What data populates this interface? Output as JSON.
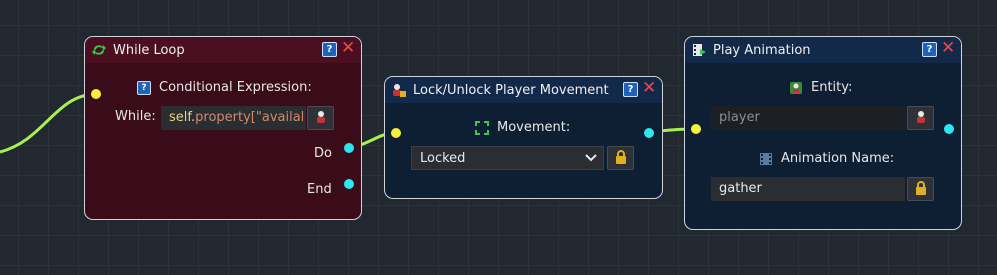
{
  "colors": {
    "wire": "#a8f050",
    "while_bg": "#3a0b18",
    "while_header": "#4a1022",
    "lock_bg": "#0e1e33",
    "lock_header": "#13294a",
    "exec_port": "#f6f03a",
    "out_port": "#2ee7ee"
  },
  "while_node": {
    "title": "While Loop",
    "help_label": "?",
    "close_label": "✕",
    "cond_label": "Conditional Expression:",
    "while_label": "While:",
    "expr_self": "self.",
    "expr_rest": "property[\"availal",
    "do_label": "Do",
    "end_label": "End"
  },
  "lock_node": {
    "title": "Lock/Unlock Player Movement",
    "help_label": "?",
    "close_label": "✕",
    "movement_label": "Movement:",
    "movement_value": "Locked"
  },
  "play_node": {
    "title": "Play Animation",
    "help_label": "?",
    "close_label": "✕",
    "entity_label": "Entity:",
    "entity_placeholder": "player",
    "anim_label": "Animation Name:",
    "anim_value": "gather"
  },
  "icons": [
    "loop-icon",
    "question-icon",
    "close-icon",
    "entity-picker-icon",
    "lock-player-icon",
    "move-arrows-icon",
    "chevron-down-icon",
    "lock-icon",
    "play-animation-icon",
    "film-icon"
  ]
}
